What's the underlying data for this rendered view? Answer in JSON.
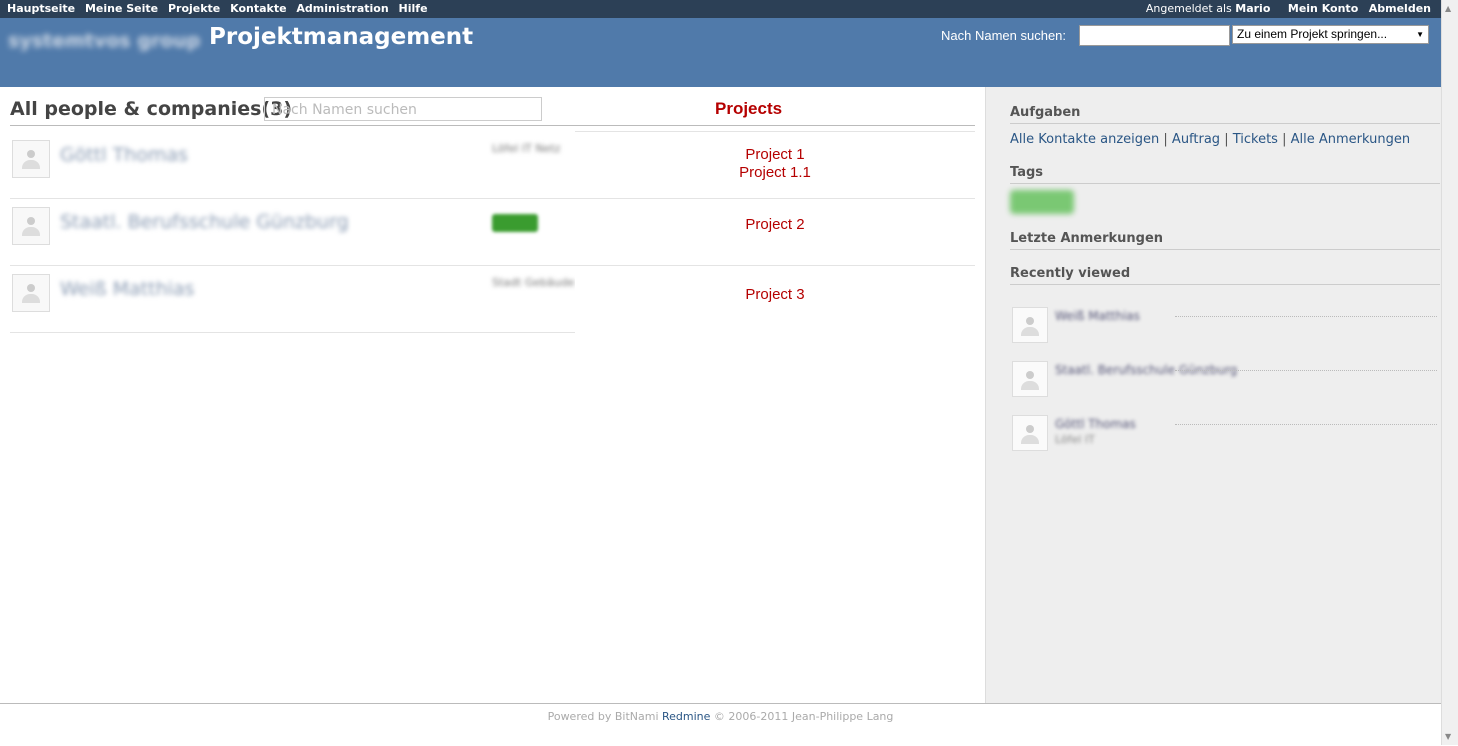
{
  "top_menu": {
    "items": [
      "Hauptseite",
      "Meine Seite",
      "Projekte",
      "Kontakte",
      "Administration",
      "Hilfe"
    ],
    "logged_in_prefix": "Angemeldet als",
    "user": "Mario",
    "account": "Mein Konto",
    "logout": "Abmelden"
  },
  "header": {
    "logo_text": "systemtvos group",
    "title": "Projektmanagement",
    "search_label": "Nach Namen suchen:",
    "search_value": "",
    "jump_label": "Zu einem Projekt springen..."
  },
  "main": {
    "list_title": "All people & companies(3)",
    "filter_placeholder": "Nach Namen suchen",
    "projects_heading": "Projects",
    "rows": [
      {
        "name": "Göttl Thomas",
        "info": "Löfel IT Netz",
        "projects": [
          "Project 1",
          "Project 1.1"
        ]
      },
      {
        "name": "Staatl. Berufsschule Günzburg",
        "info": "",
        "projects": [
          "Project 2"
        ]
      },
      {
        "name": "Weiß Matthias",
        "info": "Stadt Gebäude",
        "projects": [
          "Project 3"
        ]
      }
    ]
  },
  "sidebar": {
    "tasks_heading": "Aufgaben",
    "links": [
      "Alle Kontakte anzeigen",
      "Auftrag",
      "Tickets",
      "Alle Anmerkungen"
    ],
    "tags_heading": "Tags",
    "tag_blurred": "kunde",
    "notes_heading": "Letzte Anmerkungen",
    "recent_heading": "Recently viewed",
    "recent": [
      {
        "name": "Weiß Matthias",
        "sub": ""
      },
      {
        "name": "Staatl. Berufsschule Günzburg",
        "sub": ""
      },
      {
        "name": "Göttl Thomas",
        "sub": "Löfel IT"
      }
    ]
  },
  "footer": {
    "prefix": "Powered by BitNami ",
    "link": "Redmine",
    "suffix": " © 2006-2011 Jean-Philippe Lang"
  }
}
